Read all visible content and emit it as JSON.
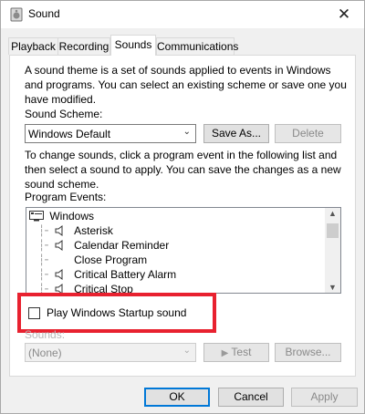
{
  "window": {
    "title": "Sound",
    "icon": "speaker-icon",
    "close_glyph": "✕"
  },
  "tabs": [
    {
      "label": "Playback"
    },
    {
      "label": "Recording"
    },
    {
      "label": "Sounds",
      "active": true
    },
    {
      "label": "Communications"
    }
  ],
  "sounds": {
    "intro": [
      "A sound theme is a set of sounds applied to events in Windows",
      "and programs.  You can select an existing scheme or save one you",
      "have modified."
    ],
    "scheme_label": "Sound Scheme:",
    "scheme_value": "Windows Default",
    "save_as": "Save As...",
    "delete": "Delete",
    "instructions": [
      "To change sounds, click a program event in the following list and",
      "then select a sound to apply.  You can save the changes as a new",
      "sound scheme."
    ],
    "events_label": "Program Events:",
    "events": [
      {
        "label": "Windows",
        "kind": "group"
      },
      {
        "label": "Asterisk",
        "kind": "sound"
      },
      {
        "label": "Calendar Reminder",
        "kind": "sound"
      },
      {
        "label": "Close Program",
        "kind": "none"
      },
      {
        "label": "Critical Battery Alarm",
        "kind": "sound"
      },
      {
        "label": "Critical Stop",
        "kind": "sound"
      }
    ],
    "startup_label": "Play Windows Startup sound",
    "startup_checked": false,
    "sounds_label": "Sounds:",
    "sound_value": "(None)",
    "test": "Test",
    "browse": "Browse..."
  },
  "footer": {
    "ok": "OK",
    "cancel": "Cancel",
    "apply": "Apply"
  },
  "colors": {
    "highlight": "#e8212f",
    "focus": "#0078d7"
  }
}
